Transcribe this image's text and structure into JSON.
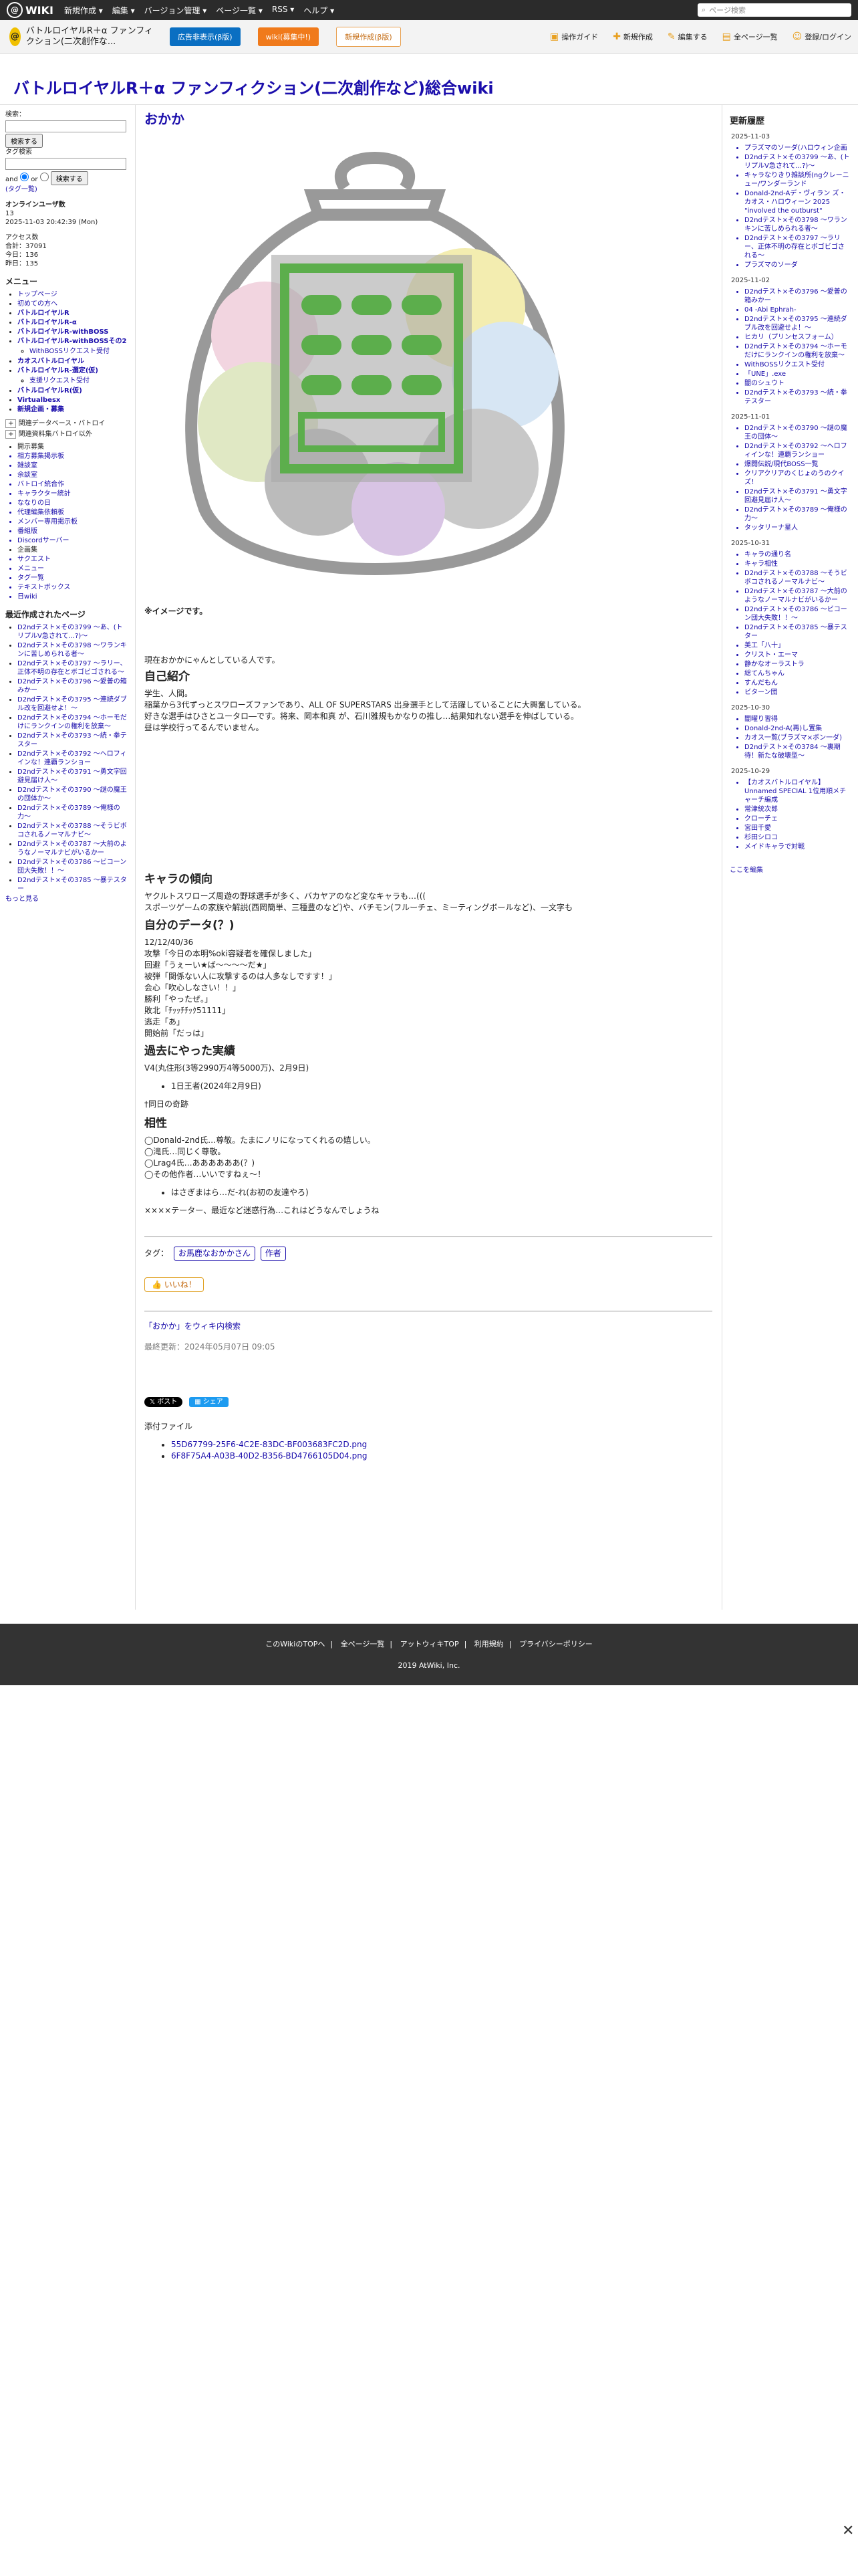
{
  "topbar": {
    "logo": "WIKI",
    "menu": [
      "新規作成 ▾",
      "編集 ▾",
      "バージョン管理 ▾",
      "ページ一覧 ▾",
      "RSS ▾",
      "ヘルプ ▾"
    ],
    "search_placeholder": "ページ検索"
  },
  "wikibar": {
    "name": "バトルロイヤルR＋α ファンフィクション(二次創作な...",
    "ad_button": "広告非表示(β版)",
    "wiki_button": "wiki(募集中!)",
    "new_button": "新規作成(β版)",
    "tools": [
      "操作ガイド",
      "新規作成",
      "編集する",
      "全ページ一覧",
      "登録/ログイン"
    ]
  },
  "page_title": "バトルロイヤルR＋α ファンフィクション(二次創作など)総合wiki",
  "left": {
    "search_label": "検索：",
    "search_button": "検索する",
    "tag_label": "タグ検索",
    "and": "and",
    "or": "or",
    "tag_help": "(タグ一覧)",
    "online_title": "オンラインユーザ数",
    "online_count": "13",
    "timestamp": "2025-11-03 20:42:39 (Mon)",
    "access": "アクセス数",
    "total": "合計：37091",
    "today": "今日：136",
    "yesterday": "昨日：135",
    "menu_title": "メニュー",
    "menu": [
      "トップページ",
      "初めての方へ",
      "バトルロイヤルR",
      "バトルロイヤルR-α",
      "バトルロイヤルR-withBOSS",
      "バトルロイヤルR-withBOSSその2",
      "WithBOSSリクエスト受付",
      "カオスバトルロイヤル",
      "バトルロイヤルR-選定(仮)",
      "支援リクエスト受付",
      "バトルロイヤルR(仮)",
      "Virtualbesx",
      "新規企画・募集"
    ],
    "sub_menu": [
      "関連データベース・バトロイ",
      "関連資料集バトロイ以外",
      "開示募集",
      "相方募集掲示板",
      "雑談室",
      "余談室",
      "バトロイ統合作",
      "キャラクター統計",
      "ななりの日",
      "代理編集依頼板",
      "メンバー専用掲示板",
      "番組版",
      "Discordサーバー",
      "企画集",
      "サクエスト",
      "メニュー",
      "タグ一覧",
      "テキストボックス",
      "日wiki"
    ],
    "recent_title": "最近作成されたページ",
    "recent": [
      "D2ndテスト×その3799 〜あ、(トリプルV急されて...?)〜",
      "D2ndテスト×その3798 〜ワランキンに苦しめられる者〜",
      "D2ndテスト×その3797 〜ラリー、正体不明の存在とボゴビゴされる〜",
      "D2ndテスト×その3796 〜愛普の箱みかー",
      "D2ndテスト×その3795 〜連続ダブル改を回避せよ！〜",
      "D2ndテスト×その3794 〜ホーモだけにランクインの権利を放棄〜",
      "D2ndテスト×その3793 〜続・拳テスター",
      "D2ndテスト×その3792 〜ヘロフィインな！連覇ランショー",
      "D2ndテスト×その3791 〜勇文字回避見届け人〜",
      "D2ndテスト×その3790 〜謎の魔王の団体か〜",
      "D2ndテスト×その3789 〜俺様の力〜",
      "D2ndテスト×その3788 〜そうビボコされるノーマルナビ〜",
      "D2ndテスト×その3787 〜大前のようなノーマルナビがいるかー",
      "D2ndテスト×その3786 〜ビコーン団大失敗！！〜",
      "D2ndテスト×その3785 〜暴テスター"
    ],
    "more": "もっと見る"
  },
  "main": {
    "heading": "おかか",
    "image_note": "※イメージです。",
    "intro": "現在おかかにゃんとしている人です。",
    "s1_title": "自己紹介",
    "s1_lines": [
      "学生、人間。",
      "稲葉から3代ずっとスワローズファンであり、ALL OF SUPERSTARS 出身選手として活躍していることに大興奮している。",
      "好きな選手はひさとユータロ―です。将来、岡本和真 が、石川雅規もかなりの推し…結果知れない選手を伸ばしている。",
      "昼は学校行ってるんでいません。"
    ],
    "s2_title": "キャラの傾向",
    "s2_lines": [
      "ヤクルトスワローズ周遊の野球選手が多く、バカヤアのなど変なキャラも…(((",
      "スポーツゲームの家族や解説(西岡簡単、三種豊のなど)や、バチモン(フルーチェ、ミーティングボールなど)、一文字も"
    ],
    "s3_title": "自分のデータ(？)",
    "s3_lines": [
      "12/12/40/36",
      "攻撃「今日の本明%oki容疑者を確保しました」",
      "回避「うぇーい★ば〜〜〜〜だ★」",
      "被弾「関係ない人に攻撃するのは人多なしですす！」",
      "会心「吹心しなさい！！」",
      "勝利「やったぜ。」",
      "敗北「ﾁｯｯﾁﾁｯｸ51111」",
      "逃走「あ」",
      "開始前「だっは」"
    ],
    "s4_title": "過去にやった実績",
    "s4_line1": "V4(丸住形(3等2990万4等5000万)、2月9日)",
    "s4_item": "1日王者(2024年2月9日)",
    "s4_line2": "†同日の奇跡",
    "s5_title": "相性",
    "s5_lines": [
      "◯Donald-2nd氏…尊敬。たまにノリになってくれるの嬉しい。",
      "◯滝氏…同じく尊敬。",
      "◯Lrag4氏…ああああああ(？)",
      "◯その他作者…いいですねぇ〜！"
    ],
    "s5_sub": "はさぎまはら…だ-れ(お初の友達やろ)",
    "s5_end": "××××テーター、最近など迷惑行為…これはどうなんでしょうね",
    "tag_label": "タグ：",
    "tags": [
      "お馬鹿なおかかさん",
      "作者"
    ],
    "like": "いいね！",
    "edit_link": "「おかか」をウィキ内検索",
    "updated": "最終更新：2024年05月07日 09:05",
    "post": "ポスト",
    "share": "シェア",
    "attach_title": "添付ファイル",
    "files": [
      "55D67799-25F6-4C2E-83DC-BF003683FC2D.png",
      "6F8F75A4-A03B-40D2-B356-BD4766105D04.png"
    ]
  },
  "right": {
    "title": "更新履歴",
    "groups": [
      {
        "date": "2025-11-03",
        "items": [
          "プラズマのソーダ(ハロウィン企画",
          "D2ndテスト×その3799 〜あ、(トリプルV急されて...?)〜",
          "キャラなりきり雑談所(ngクレーニュー/ワンダーランド",
          "Donald-2nd-Aデ・ヴィラン ズ・カオス・ハロウィーン 2025 \"involved the outburst\"",
          "D2ndテスト×その3798 〜ワランキンに苦しめられる者〜",
          "D2ndテスト×その3797 〜ラリー、正体不明の存在とボゴビゴされる〜",
          "プラズマのソーダ"
        ]
      },
      {
        "date": "2025-11-02",
        "items": [
          "D2ndテスト×その3796 〜愛普の箱みかー",
          "04 -Abi Ephrah-",
          "D2ndテスト×その3795 〜連続ダブル改を回避せよ！〜",
          "ヒカリ（プリンセスフォーム）",
          "D2ndテスト×その3794 〜ホーモだけにランクインの権利を放棄〜",
          "WithBOSSリクエスト受付",
          "「UNE」.exe",
          "闇のシュウト",
          "D2ndテスト×その3793 〜続・拳テスター"
        ]
      },
      {
        "date": "2025-11-01",
        "items": [
          "D2ndテスト×その3790 〜謎の魔王の団体〜",
          "D2ndテスト×その3792 〜ヘロフィインな！連覇ランショー",
          "爆闘伝説/現代BOSS一覧",
          "クリアクリアのくじょのうのクイズ！",
          "D2ndテスト×その3791 〜勇文字回避見届け人〜",
          "D2ndテスト×その3789 〜俺様の力〜",
          "タッタリーナ星人"
        ]
      },
      {
        "date": "2025-10-31",
        "items": [
          "キャラの通り名",
          "キャラ相性",
          "D2ndテスト×その3788 〜そうビボコされるノーマルナビ〜",
          "D2ndテスト×その3787 〜大前のようなノーマルナビがいるかー",
          "D2ndテスト×その3786 〜ビコーン団大失敗！！〜",
          "D2ndテスト×その3785 〜暴テスター",
          "美工「八十」",
          "クリスト・エーマ",
          "静かなオーラストラ",
          "総てんちゃん",
          "すんだもん",
          "ビターン団"
        ]
      },
      {
        "date": "2025-10-30",
        "items": [
          "闇曜り習得",
          "Donald-2nd-A(再)し置集",
          "カオス一覧(ブラズマ×ボン一ダ)",
          "D2ndテスト×その3784 〜裏期待！新たな破壊型〜"
        ]
      },
      {
        "date": "2025-10-29",
        "items": [
          "【カオスバトルロイヤル】Unnamed SPECIAL 1位用順メチャーチ編成",
          "常津統次郎",
          "クローチェ",
          "宮田千愛",
          "杉田シロコ",
          "メイドキャラで対戦"
        ]
      }
    ],
    "edit_link": "ここを編集"
  },
  "footer": {
    "links": [
      "このWikiのTOPへ",
      "全ページ一覧",
      "アットウィキTOP",
      "利用規約",
      "プライバシーポリシー"
    ],
    "copy": "2019 AtWiki, Inc."
  },
  "colors": {
    "topbar": "#2b2b2b",
    "link": "#1a0dab",
    "accent": "#f07a1b",
    "ad": "#0a6fc2"
  }
}
